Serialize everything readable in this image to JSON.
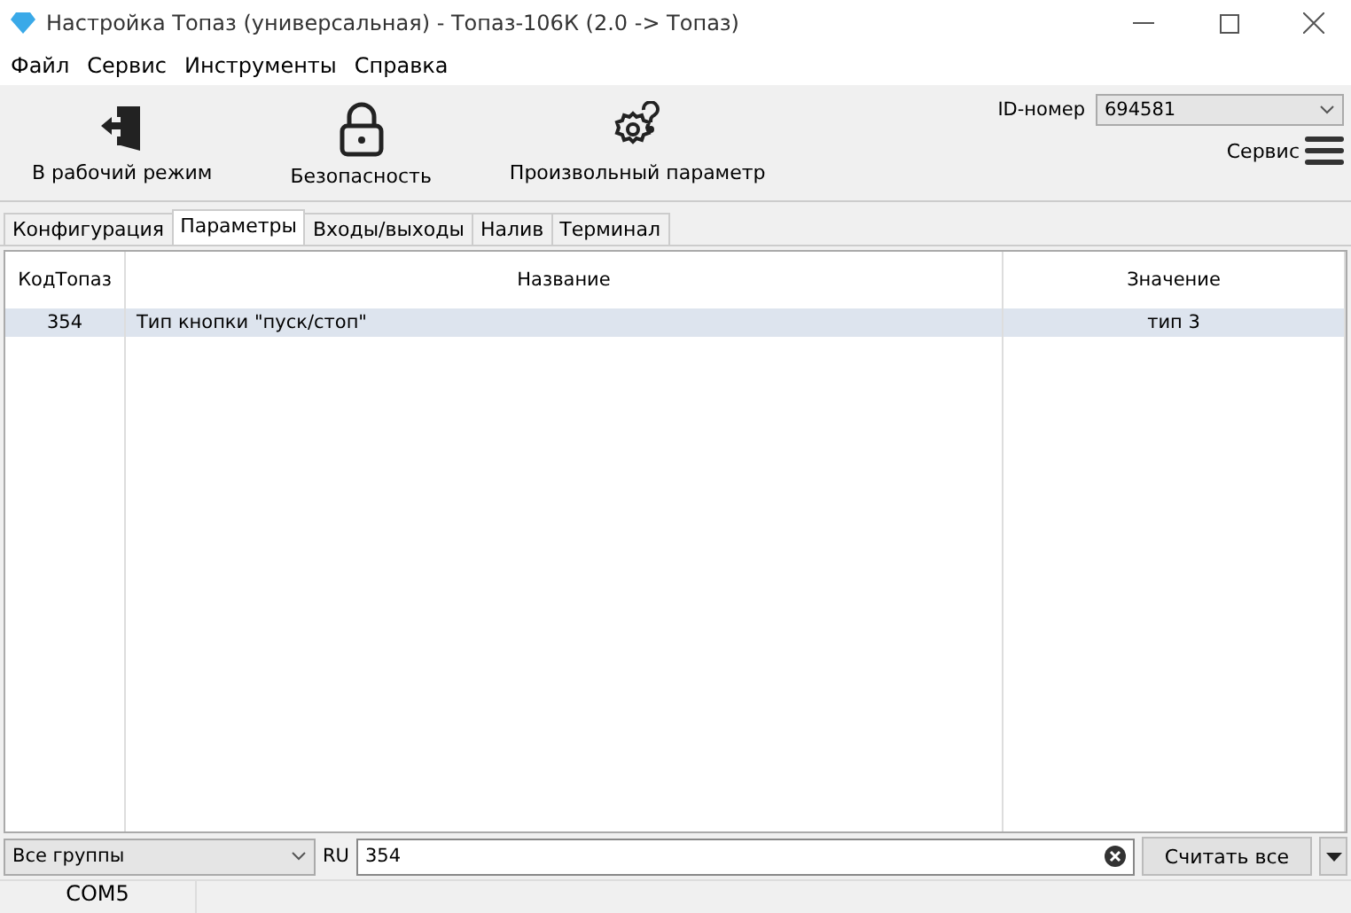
{
  "window": {
    "title": "Настройка Топаз (универсальная) - Топаз-106К (2.0 -> Топаз)"
  },
  "menu": [
    "Файл",
    "Сервис",
    "Инструменты",
    "Справка"
  ],
  "toolbar": [
    {
      "label": "В рабочий режим",
      "kind": "exit"
    },
    {
      "label": "Безопасность",
      "kind": "lock"
    },
    {
      "label": "Произвольный параметр",
      "kind": "gear"
    }
  ],
  "id_field": {
    "label": "ID-номер",
    "value": "694581"
  },
  "service_menu": {
    "label": "Сервис"
  },
  "tabs": [
    {
      "label": "Конфигурация",
      "selected": false
    },
    {
      "label": "Параметры",
      "selected": true
    },
    {
      "label": "Входы/выходы",
      "selected": false
    },
    {
      "label": "Налив",
      "selected": false
    },
    {
      "label": "Терминал",
      "selected": false
    }
  ],
  "table": {
    "columns": [
      "КодТопаз",
      "Название",
      "Значение"
    ],
    "rows": [
      {
        "cells": [
          "354",
          "Тип кнопки \"пуск/стоп\"",
          "тип 3"
        ],
        "selected": true
      }
    ]
  },
  "filter": {
    "group": "Все группы",
    "language": "RU",
    "search": "354",
    "button": "Считать все"
  },
  "status_bar": [
    "COM5"
  ]
}
